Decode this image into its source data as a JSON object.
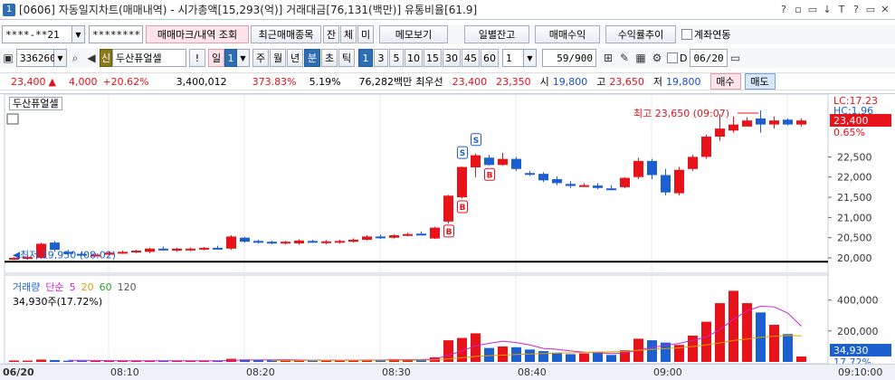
{
  "window": {
    "badge": "1",
    "title": "[0606] 자동일지차트(매매내역) - 시가총액[15,293(억)] 거래대금[76,131(백만)] 유통비율[61.9]",
    "controls": [
      "?",
      "▫",
      "▭",
      "↓",
      "T",
      "?",
      "▭",
      "✕"
    ]
  },
  "toolbar1": {
    "account": "****-**21",
    "password": "********",
    "btn_marks": "매매마크/내역 조회",
    "btn_recent": "최근매매종목",
    "btn_jan": "잔",
    "btn_che": "체",
    "btn_mi": "미",
    "btn_memo": "메모보기",
    "btn_daily": "일별잔고",
    "btn_profit": "매매수익",
    "btn_rate": "수익률추이",
    "chk_link": "계좌연동"
  },
  "toolbar2": {
    "code": "336260",
    "sin": "신",
    "stock_name": "두산퓨얼셀",
    "excl": "!",
    "period_il": "일",
    "period_num": "1",
    "periods": [
      "주",
      "월",
      "년",
      "분",
      "초",
      "틱"
    ],
    "active_period": "분",
    "intervals": [
      "1",
      "3",
      "5",
      "10",
      "15",
      "30",
      "45",
      "60"
    ],
    "active_interval": "1",
    "custom": "1",
    "count_value": "59",
    "count_total": "/900",
    "d_label": "D",
    "date_value": "06/20"
  },
  "quote": {
    "price": "23,400",
    "arrow": "▲",
    "change": "4,000",
    "rate": "+20.62%",
    "volume": "3,400,012",
    "vol_ratio": "373.83%",
    "turnover": "5.19%",
    "amount": "76,282백만",
    "bid_label": "최우선",
    "ask1": "23,400",
    "bid1": "23,350",
    "open_label": "시",
    "open": "19,800",
    "high_label": "고",
    "high": "23,650",
    "low_label": "저",
    "low": "19,800",
    "buy_btn": "매수",
    "sell_btn": "매도"
  },
  "chart_panel": {
    "stock_label": "두산퓨얼셀",
    "lc_label": "LC:17.23",
    "hc_label": "HC:1.96",
    "current_price_tag": "23,400",
    "current_rate_tag": "0.65%",
    "high_annotation": "최고 23,650 (09:07)",
    "low_annotation": "최저 19,950 (08:02)",
    "price_ticks": [
      "22,500",
      "22,000",
      "21,500",
      "21,000",
      "20,500",
      "20,000"
    ],
    "vol_ticks": [
      "400,000",
      "200,000"
    ],
    "vol_tag": "34,930",
    "vol_rate_tag": "17.72%",
    "vol_legend": {
      "name": "거래량",
      "ma": "단순",
      "p5": "5",
      "p20": "20",
      "p60": "60",
      "p120": "120",
      "info": "34,930주(17.72%)"
    },
    "colors": {
      "up": "#e8121b",
      "down": "#1c5fd1",
      "ma5": "#cc22cc",
      "ma20": "#e0a000",
      "ma60": "#2aa02a",
      "baseline": "#000000"
    }
  },
  "time_axis": {
    "labels": [
      "06/20",
      "08:10",
      "08:20",
      "08:30",
      "08:40",
      "09:00",
      "09:10:00"
    ]
  },
  "chart_data": {
    "type": "candlestick",
    "title": "",
    "xlabel": "",
    "ylabel": "",
    "ylim": [
      19800,
      23650
    ],
    "reference_price": 19950,
    "candles": [
      {
        "o": 19960,
        "h": 20020,
        "l": 19950,
        "c": 20000
      },
      {
        "o": 20000,
        "h": 20080,
        "l": 19960,
        "c": 20020
      },
      {
        "o": 20000,
        "h": 20380,
        "l": 19980,
        "c": 20350
      },
      {
        "o": 20380,
        "h": 20420,
        "l": 20150,
        "c": 20200
      },
      {
        "o": 20150,
        "h": 20200,
        "l": 20060,
        "c": 20100
      },
      {
        "o": 20100,
        "h": 20160,
        "l": 20060,
        "c": 20080
      },
      {
        "o": 20060,
        "h": 20120,
        "l": 20040,
        "c": 20080
      },
      {
        "o": 20080,
        "h": 20150,
        "l": 20060,
        "c": 20130
      },
      {
        "o": 20130,
        "h": 20180,
        "l": 20100,
        "c": 20150
      },
      {
        "o": 20150,
        "h": 20200,
        "l": 20120,
        "c": 20180
      },
      {
        "o": 20150,
        "h": 20250,
        "l": 20120,
        "c": 20230
      },
      {
        "o": 20230,
        "h": 20280,
        "l": 20180,
        "c": 20200
      },
      {
        "o": 20180,
        "h": 20250,
        "l": 20150,
        "c": 20230
      },
      {
        "o": 20200,
        "h": 20260,
        "l": 20170,
        "c": 20230
      },
      {
        "o": 20230,
        "h": 20270,
        "l": 20190,
        "c": 20250
      },
      {
        "o": 20250,
        "h": 20300,
        "l": 20220,
        "c": 20240
      },
      {
        "o": 20230,
        "h": 20560,
        "l": 20200,
        "c": 20530
      },
      {
        "o": 20500,
        "h": 20520,
        "l": 20380,
        "c": 20400
      },
      {
        "o": 20420,
        "h": 20450,
        "l": 20350,
        "c": 20380
      },
      {
        "o": 20400,
        "h": 20430,
        "l": 20340,
        "c": 20370
      },
      {
        "o": 20380,
        "h": 20420,
        "l": 20330,
        "c": 20400
      },
      {
        "o": 20360,
        "h": 20460,
        "l": 20330,
        "c": 20430
      },
      {
        "o": 20420,
        "h": 20450,
        "l": 20370,
        "c": 20400
      },
      {
        "o": 20380,
        "h": 20440,
        "l": 20340,
        "c": 20410
      },
      {
        "o": 20380,
        "h": 20450,
        "l": 20350,
        "c": 20420
      },
      {
        "o": 20400,
        "h": 20480,
        "l": 20380,
        "c": 20450
      },
      {
        "o": 20450,
        "h": 20560,
        "l": 20430,
        "c": 20530
      },
      {
        "o": 20530,
        "h": 20580,
        "l": 20470,
        "c": 20500
      },
      {
        "o": 20500,
        "h": 20580,
        "l": 20480,
        "c": 20560
      },
      {
        "o": 20560,
        "h": 20620,
        "l": 20540,
        "c": 20590
      },
      {
        "o": 20600,
        "h": 20650,
        "l": 20560,
        "c": 20580
      },
      {
        "o": 20480,
        "h": 20770,
        "l": 20470,
        "c": 20750
      },
      {
        "o": 20900,
        "h": 21560,
        "l": 20850,
        "c": 21540
      },
      {
        "o": 21500,
        "h": 22260,
        "l": 21470,
        "c": 22250
      },
      {
        "o": 22240,
        "h": 22580,
        "l": 22000,
        "c": 22540
      },
      {
        "o": 22480,
        "h": 22550,
        "l": 22280,
        "c": 22300
      },
      {
        "o": 22300,
        "h": 22600,
        "l": 22280,
        "c": 22450
      },
      {
        "o": 22450,
        "h": 22500,
        "l": 22150,
        "c": 22200
      },
      {
        "o": 22100,
        "h": 22150,
        "l": 22030,
        "c": 22080
      },
      {
        "o": 22080,
        "h": 22120,
        "l": 21880,
        "c": 21920
      },
      {
        "o": 21950,
        "h": 22020,
        "l": 21800,
        "c": 21850
      },
      {
        "o": 21830,
        "h": 21900,
        "l": 21730,
        "c": 21780
      },
      {
        "o": 21780,
        "h": 21850,
        "l": 21760,
        "c": 21800
      },
      {
        "o": 21790,
        "h": 21850,
        "l": 21700,
        "c": 21730
      },
      {
        "o": 21720,
        "h": 21800,
        "l": 21680,
        "c": 21700
      },
      {
        "o": 21750,
        "h": 22000,
        "l": 21720,
        "c": 21980
      },
      {
        "o": 22000,
        "h": 22480,
        "l": 21950,
        "c": 22400
      },
      {
        "o": 22400,
        "h": 22450,
        "l": 21950,
        "c": 22050
      },
      {
        "o": 22050,
        "h": 22200,
        "l": 21550,
        "c": 21620
      },
      {
        "o": 21600,
        "h": 22250,
        "l": 21550,
        "c": 22180
      },
      {
        "o": 22200,
        "h": 22550,
        "l": 22150,
        "c": 22500
      },
      {
        "o": 22500,
        "h": 23050,
        "l": 22450,
        "c": 23000
      },
      {
        "o": 23000,
        "h": 23560,
        "l": 22900,
        "c": 23200
      },
      {
        "o": 23150,
        "h": 23500,
        "l": 23100,
        "c": 23300
      },
      {
        "o": 23250,
        "h": 23480,
        "l": 23300,
        "c": 23400
      },
      {
        "o": 23450,
        "h": 23650,
        "l": 23100,
        "c": 23300
      },
      {
        "o": 23300,
        "h": 23500,
        "l": 23200,
        "c": 23400
      },
      {
        "o": 23420,
        "h": 23450,
        "l": 23280,
        "c": 23300
      },
      {
        "o": 23300,
        "h": 23450,
        "l": 23250,
        "c": 23400
      }
    ],
    "volume": [
      9000,
      8000,
      15000,
      12000,
      8000,
      7000,
      6000,
      8000,
      7000,
      7500,
      8000,
      7000,
      7500,
      8000,
      7000,
      8000,
      20000,
      16000,
      12000,
      10000,
      11000,
      12000,
      10000,
      11000,
      10000,
      12000,
      15000,
      14000,
      18000,
      15000,
      14000,
      30000,
      140000,
      155000,
      185000,
      90000,
      100000,
      95000,
      80000,
      70000,
      60000,
      50000,
      55000,
      60000,
      45000,
      75000,
      150000,
      140000,
      125000,
      110000,
      170000,
      260000,
      380000,
      460000,
      380000,
      320000,
      240000,
      180000,
      34930
    ],
    "markers": [
      {
        "index": 32,
        "type": "B"
      },
      {
        "index": 33,
        "type": "S"
      },
      {
        "index": 33,
        "type": "B"
      },
      {
        "index": 34,
        "type": "S"
      },
      {
        "index": 35,
        "type": "B"
      }
    ]
  }
}
